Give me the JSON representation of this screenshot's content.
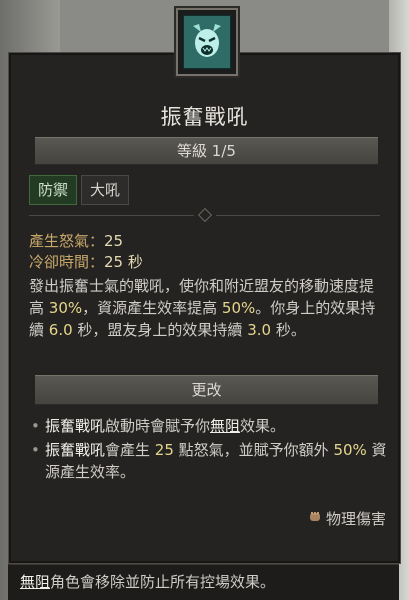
{
  "skill": {
    "name": "振奮戰吼",
    "rank": "等級 1/5",
    "tags": [
      "防禦",
      "大吼"
    ]
  },
  "stats": {
    "fury_label": "產生怒氣：",
    "fury_value": "25",
    "cooldown_label": "冷卻時間：",
    "cooldown_value": "25 秒"
  },
  "description": {
    "part1": "發出振奮士氣的戰吼，使你和附近盟友的移動速度提高 ",
    "move_speed": "30%",
    "part2": "，資源產生效率提高 ",
    "resource": "50%",
    "part3": "。你身上的效果持續 ",
    "self_duration": "6.0",
    "part4": " 秒，盟友身上的效果持續 ",
    "ally_duration": "3.0",
    "part5": " 秒。"
  },
  "upgrades": {
    "header": "更改",
    "item1": {
      "skill": "振奮戰吼",
      "text1": "啟動時會賦予你",
      "keyword": "無阻",
      "text2": "效果。"
    },
    "item2": {
      "skill": "振奮戰吼",
      "text1": "會產生 ",
      "fury": "25",
      "text2": " 點怒氣，並賦予你額外 ",
      "resource": "50%",
      "text3": " 資源產生效率。"
    }
  },
  "damage_type": "物理傷害",
  "footer": {
    "keyword": "無阻",
    "text": "角色會移除並防止所有控場效果。"
  },
  "icons": {
    "skill": "roaring-face-icon",
    "damage": "fist-icon"
  },
  "colors": {
    "highlight": "#e6d68b",
    "defense_tag": "#233b22",
    "skill_icon": "#2f6c67"
  }
}
